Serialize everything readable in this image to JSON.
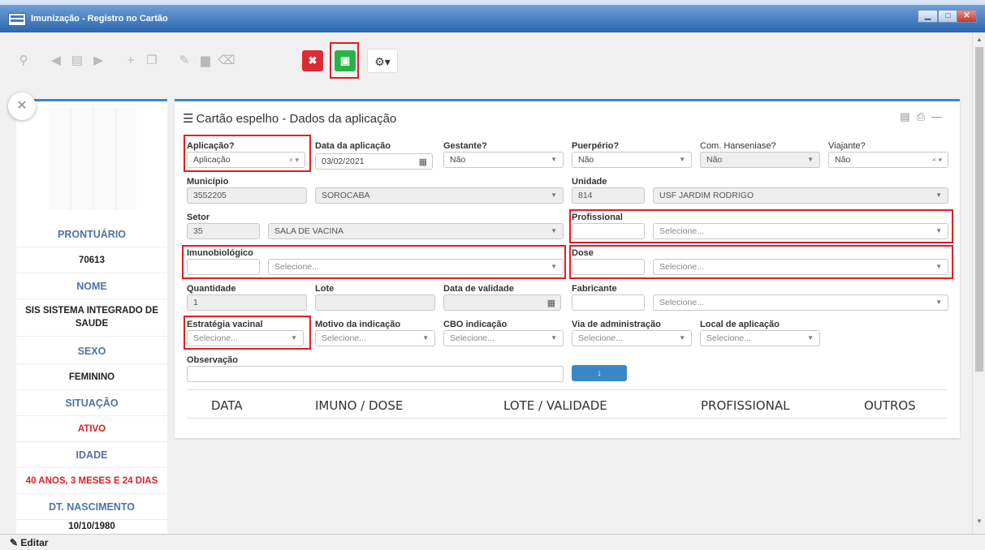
{
  "window": {
    "title": "Imunização - Registro no Cartão",
    "controls": [
      "minimize",
      "maximize",
      "close"
    ]
  },
  "toolbar": {
    "icons": [
      "search-icon",
      "prev-icon",
      "list-icon",
      "next-icon",
      "add-icon",
      "copy-icon",
      "edit-icon",
      "delete-icon",
      "eraser-icon",
      "cancel-icon",
      "save-icon",
      "settings-icon"
    ]
  },
  "sidebar": {
    "rows": [
      {
        "label": "PRONTUÁRIO",
        "value": "70613"
      },
      {
        "label": "NOME",
        "value": "SIS SISTEMA INTEGRADO DE SAUDE"
      },
      {
        "label": "SEXO",
        "value": "FEMININO"
      },
      {
        "label": "SITUAÇÃO",
        "value": "ATIVO"
      },
      {
        "label": "IDADE",
        "value": "40 ANOS, 3 MESES E 24 DIAS"
      },
      {
        "label": "DT. NASCIMENTO",
        "value": "10/10/1980"
      }
    ]
  },
  "panel": {
    "title": "Cartão espelho - Dados da aplicação"
  },
  "form": {
    "aplicacao": {
      "label": "Aplicação?",
      "value": "Aplicação"
    },
    "data_aplicacao": {
      "label": "Data da aplicação",
      "value": "03/02/2021"
    },
    "gestante": {
      "label": "Gestante?",
      "value": "Não"
    },
    "puerperio": {
      "label": "Puerpério?",
      "value": "Não"
    },
    "hanseniase": {
      "label": "Com. Hanseniase?",
      "value": "Não"
    },
    "viajante": {
      "label": "Viajante?",
      "value": "Não"
    },
    "municipio": {
      "label": "Município",
      "code": "3552205",
      "name": "SOROCABA"
    },
    "unidade": {
      "label": "Unidade",
      "code": "814",
      "name": "USF JARDIM RODRIGO"
    },
    "setor": {
      "label": "Setor",
      "code": "35",
      "name": "SALA DE VACINA"
    },
    "profissional": {
      "label": "Profissional",
      "placeholder": "Selecione..."
    },
    "imunobiologico": {
      "label": "Imunobiológico",
      "placeholder": "Selecione..."
    },
    "dose": {
      "label": "Dose",
      "placeholder": "Selecione..."
    },
    "quantidade": {
      "label": "Quantidade",
      "value": "1"
    },
    "lote": {
      "label": "Lote",
      "value": ""
    },
    "validade": {
      "label": "Data de validade",
      "value": ""
    },
    "fabricante": {
      "label": "Fabricante",
      "placeholder": "Selecione..."
    },
    "estrategia": {
      "label": "Estratégia vacinal",
      "placeholder": "Selecione..."
    },
    "motivo": {
      "label": "Motivo da indicação",
      "placeholder": "Selecione..."
    },
    "cbo": {
      "label": "CBO indicação",
      "placeholder": "Selecione..."
    },
    "via": {
      "label": "Via de administração",
      "placeholder": "Selecione..."
    },
    "local": {
      "label": "Local de aplicação",
      "placeholder": "Selecione..."
    },
    "observacao": {
      "label": "Observação",
      "value": ""
    }
  },
  "table": {
    "columns": [
      "DATA",
      "IMUNO / DOSE",
      "LOTE / VALIDADE",
      "PROFISSIONAL",
      "OUTROS"
    ]
  },
  "statusbar": {
    "edit_label": "Editar"
  }
}
